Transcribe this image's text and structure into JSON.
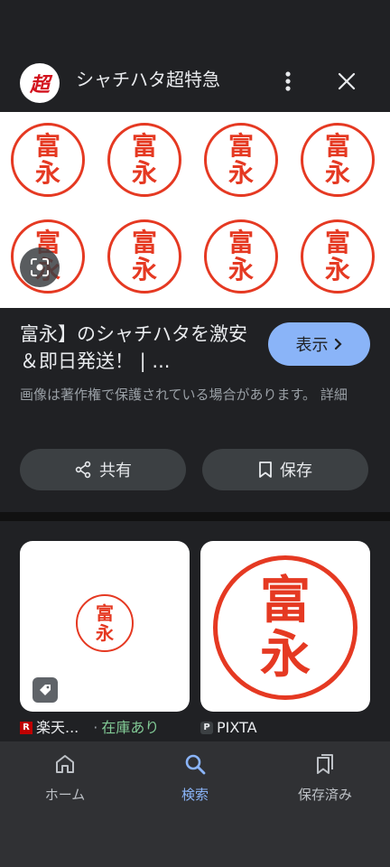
{
  "header": {
    "logo_text": "超",
    "site_name": "シャチハタ超特急"
  },
  "image": {
    "stamps": [
      {
        "top": "富",
        "bottom": "永"
      },
      {
        "top": "富",
        "bottom": "永"
      },
      {
        "top": "富",
        "bottom": "永"
      },
      {
        "top": "富",
        "bottom": "永"
      },
      {
        "top": "富",
        "bottom": "永"
      },
      {
        "top": "富",
        "bottom": "永"
      },
      {
        "top": "富",
        "bottom": "永"
      },
      {
        "top": "富",
        "bottom": "永"
      }
    ]
  },
  "info": {
    "title": "富永】のシャチハタを激安＆即日発送！ | ...",
    "visit_label": "表示",
    "copyright": "画像は著作権で保護されている場合があります。 詳細",
    "share_label": "共有",
    "save_label": "保存"
  },
  "related": [
    {
      "source_name": "楽天...",
      "status": "在庫あり",
      "stamp_top": "富",
      "stamp_bottom": "永"
    },
    {
      "source_name": "PIXTA",
      "stamp_top": "富",
      "stamp_bottom": "永"
    }
  ],
  "nav": [
    {
      "label": "ホーム",
      "icon": "home-icon"
    },
    {
      "label": "検索",
      "icon": "search-icon",
      "active": true
    },
    {
      "label": "保存済み",
      "icon": "collections-icon"
    }
  ],
  "colors": {
    "background": "#202124",
    "accent": "#8ab4f8",
    "stamp_red": "#e53922",
    "in_stock_green": "#81c995"
  }
}
